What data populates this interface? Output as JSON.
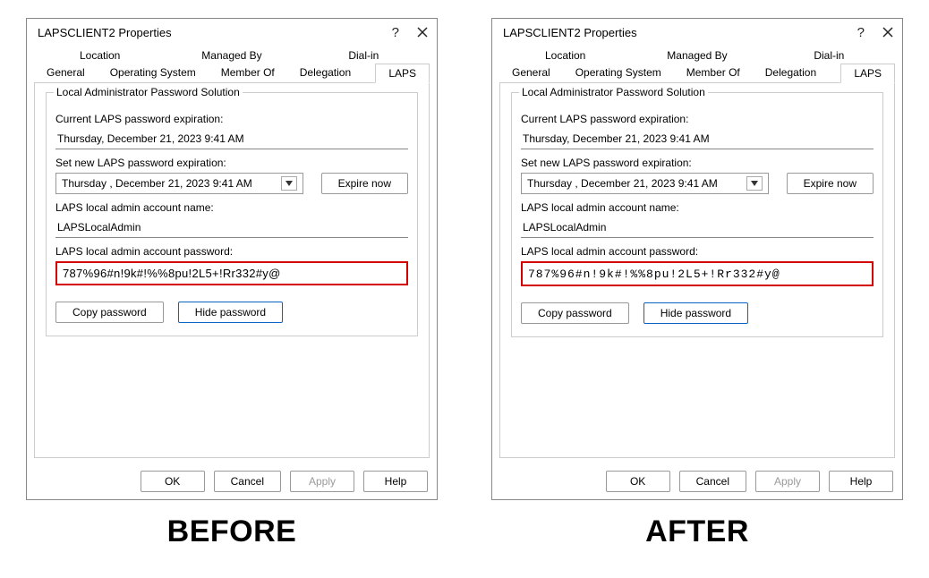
{
  "captions": {
    "before": "BEFORE",
    "after": "AFTER"
  },
  "before": {
    "title": "LAPSCLIENT2 Properties",
    "tabs_row1": {
      "location": "Location",
      "managed_by": "Managed By",
      "dial_in": "Dial-in"
    },
    "tabs_row2": {
      "general": "General",
      "os": "Operating System",
      "member_of": "Member Of",
      "delegation": "Delegation",
      "laps": "LAPS"
    },
    "group_label": "Local Administrator Password Solution",
    "labels": {
      "current_exp": "Current LAPS password expiration:",
      "set_new_exp": "Set new LAPS password expiration:",
      "account_name": "LAPS local admin account name:",
      "account_pw": "LAPS local admin account password:"
    },
    "values": {
      "current_exp_value": "Thursday, December 21, 2023 9:41 AM",
      "set_new_exp_value": "Thursday , December 21, 2023   9:41 AM",
      "account_name_value": "LAPSLocalAdmin",
      "password": "787%96#n!9k#!%%8pu!2L5+!Rr332#y@"
    },
    "buttons": {
      "expire_now": "Expire now",
      "copy_pw": "Copy password",
      "hide_pw": "Hide password",
      "ok": "OK",
      "cancel": "Cancel",
      "apply": "Apply",
      "help": "Help"
    }
  },
  "after": {
    "title": "LAPSCLIENT2 Properties",
    "tabs_row1": {
      "location": "Location",
      "managed_by": "Managed By",
      "dial_in": "Dial-in"
    },
    "tabs_row2": {
      "general": "General",
      "os": "Operating System",
      "member_of": "Member Of",
      "delegation": "Delegation",
      "laps": "LAPS"
    },
    "group_label": "Local Administrator Password Solution",
    "labels": {
      "current_exp": "Current LAPS password expiration:",
      "set_new_exp": "Set new LAPS password expiration:",
      "account_name": "LAPS local admin account name:",
      "account_pw": "LAPS local admin account password:"
    },
    "values": {
      "current_exp_value": "Thursday, December 21, 2023 9:41 AM",
      "set_new_exp_value": "Thursday , December 21, 2023   9:41 AM",
      "account_name_value": "LAPSLocalAdmin",
      "password": "787%96#n!9k#!%%8pu!2L5+!Rr332#y@"
    },
    "buttons": {
      "expire_now": "Expire now",
      "copy_pw": "Copy password",
      "hide_pw": "Hide password",
      "ok": "OK",
      "cancel": "Cancel",
      "apply": "Apply",
      "help": "Help"
    }
  }
}
